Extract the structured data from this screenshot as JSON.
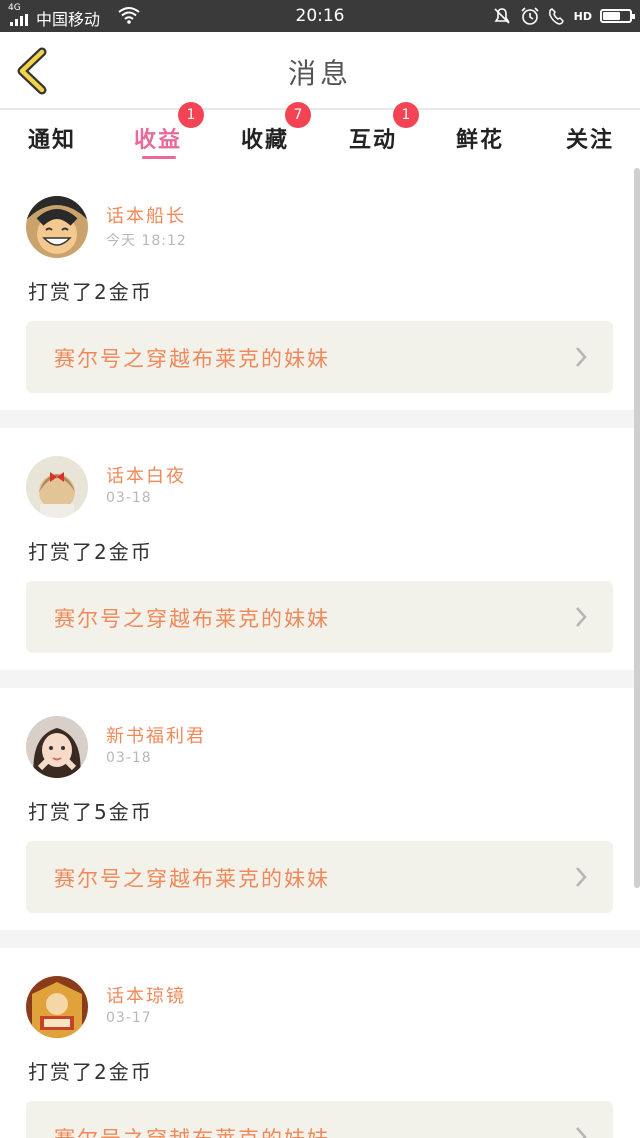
{
  "status_bar": {
    "network": "4G",
    "carrier": "中国移动",
    "time": "20:16",
    "hd": "HD",
    "battery_level": 0.65
  },
  "header": {
    "title": "消息"
  },
  "tabs": [
    {
      "label": "通知",
      "badge": ""
    },
    {
      "label": "收益",
      "badge": "1"
    },
    {
      "label": "收藏",
      "badge": "7"
    },
    {
      "label": "互动",
      "badge": "1"
    },
    {
      "label": "鲜花",
      "badge": ""
    },
    {
      "label": "关注",
      "badge": ""
    }
  ],
  "messages": [
    {
      "name": "话本船长",
      "date": "今天 18:12",
      "action": "打赏了2金币",
      "book": "赛尔号之穿越布莱克的妹妹"
    },
    {
      "name": "话本白夜",
      "date": "03-18",
      "action": "打赏了2金币",
      "book": "赛尔号之穿越布莱克的妹妹"
    },
    {
      "name": "新书福利君",
      "date": "03-18",
      "action": "打赏了5金币",
      "book": "赛尔号之穿越布莱克的妹妹"
    },
    {
      "name": "话本琼镜",
      "date": "03-17",
      "action": "打赏了2金币",
      "book": "赛尔号之穿越布莱克的妹妹"
    }
  ],
  "colors": {
    "accent": "#e86a9a",
    "name": "#f0895a",
    "badge": "#f44354",
    "link_bg": "#f3f2ea"
  }
}
